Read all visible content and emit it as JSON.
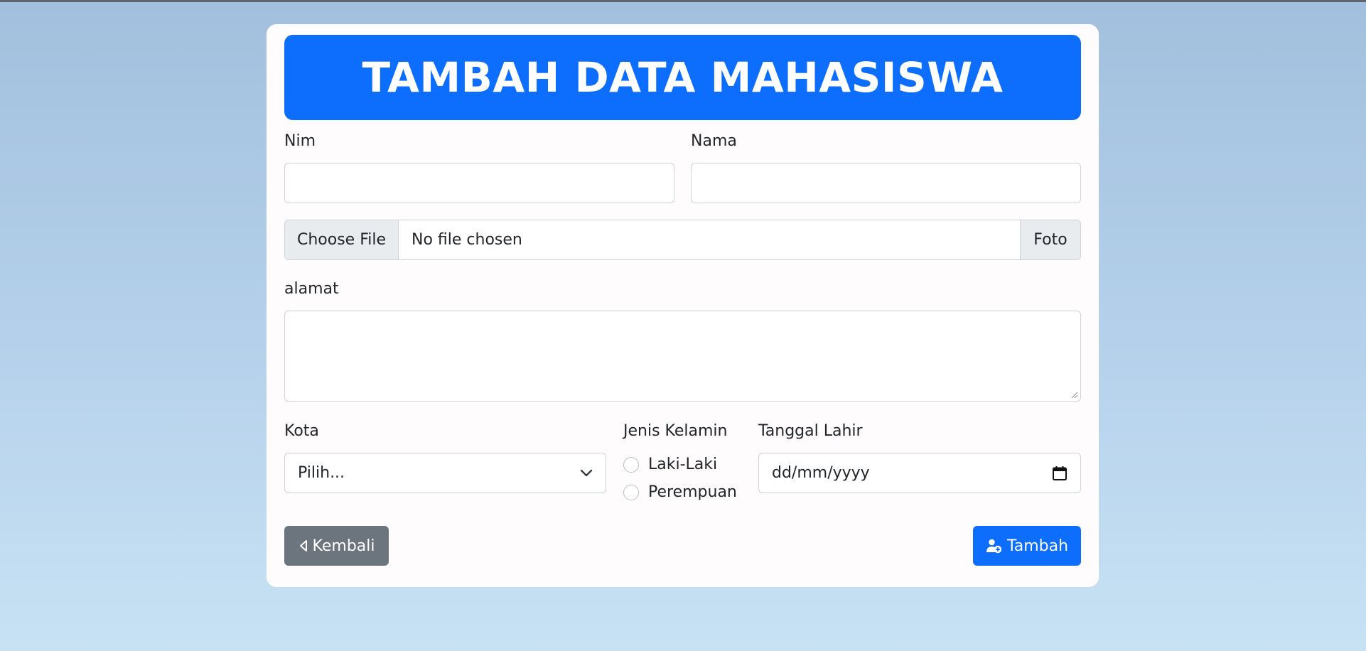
{
  "page": {
    "title": "TAMBAH DATA MAHASISWA"
  },
  "form": {
    "nim": {
      "label": "Nim",
      "value": ""
    },
    "nama": {
      "label": "Nama",
      "value": ""
    },
    "foto": {
      "button_label": "Choose File",
      "file_name": "No file chosen",
      "addon_label": "Foto"
    },
    "alamat": {
      "label": "alamat",
      "value": ""
    },
    "kota": {
      "label": "Kota",
      "selected": "Pilih..."
    },
    "jenis_kelamin": {
      "label": "Jenis Kelamin",
      "options": [
        "Laki-Laki",
        "Perempuan"
      ]
    },
    "tanggal_lahir": {
      "label": "Tanggal Lahir",
      "placeholder": "dd/mm/yyyy"
    }
  },
  "actions": {
    "back_label": "Kembali",
    "add_label": "Tambah"
  },
  "colors": {
    "primary": "#0d6efd",
    "secondary": "#6c757d"
  }
}
